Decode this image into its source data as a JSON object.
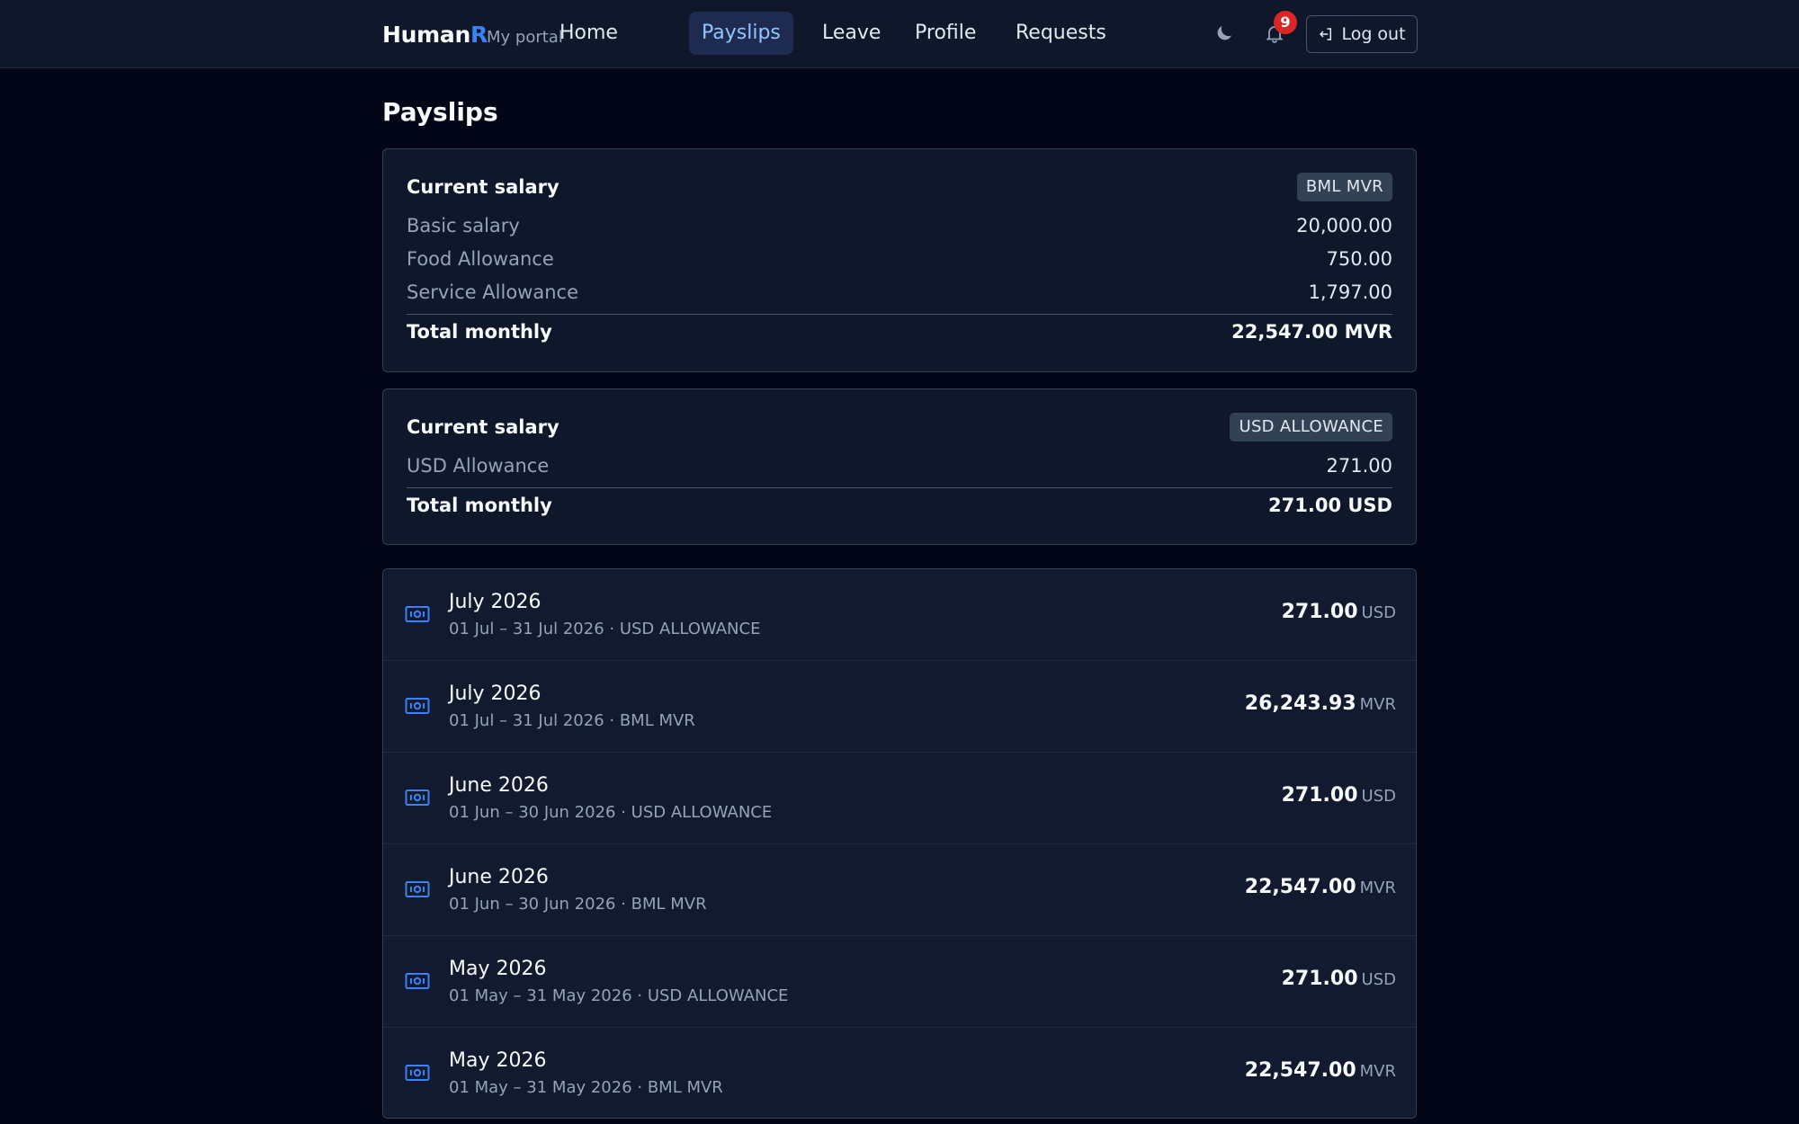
{
  "nav": {
    "brand_main": "Human",
    "brand_accent": "R",
    "portal": "My portal",
    "links": [
      {
        "label": "Home",
        "active": false
      },
      {
        "label": "Payslips",
        "active": true
      },
      {
        "label": "Leave",
        "active": false
      },
      {
        "label": "Profile",
        "active": false
      },
      {
        "label": "Requests",
        "active": false
      }
    ],
    "theme_icon": "moon-icon",
    "notifications_icon": "bell-icon",
    "notification_count": "9",
    "logout_label": "Log out",
    "logout_icon": "logout-icon"
  },
  "page": {
    "title": "Payslips"
  },
  "salary_cards": [
    {
      "title": "Current salary",
      "tag": "BML MVR",
      "lines": [
        {
          "label": "Basic salary",
          "value": "20,000.00"
        },
        {
          "label": "Food Allowance",
          "value": "750.00"
        },
        {
          "label": "Service Allowance",
          "value": "1,797.00"
        }
      ],
      "total_label": "Total monthly",
      "total_value": "22,547.00 MVR"
    },
    {
      "title": "Current salary",
      "tag": "USD ALLOWANCE",
      "lines": [
        {
          "label": "USD Allowance",
          "value": "271.00"
        }
      ],
      "total_label": "Total monthly",
      "total_value": "271.00 USD"
    }
  ],
  "payslips": [
    {
      "title": "July 2026",
      "sub": "01 Jul – 31 Jul 2026 · USD ALLOWANCE",
      "amount": "271.00",
      "currency": "USD",
      "icon": "banknote-icon"
    },
    {
      "title": "July 2026",
      "sub": "01 Jul – 31 Jul 2026 · BML MVR",
      "amount": "26,243.93",
      "currency": "MVR",
      "icon": "banknote-icon"
    },
    {
      "title": "June 2026",
      "sub": "01 Jun – 30 Jun 2026 · USD ALLOWANCE",
      "amount": "271.00",
      "currency": "USD",
      "icon": "banknote-icon"
    },
    {
      "title": "June 2026",
      "sub": "01 Jun – 30 Jun 2026 · BML MVR",
      "amount": "22,547.00",
      "currency": "MVR",
      "icon": "banknote-icon"
    },
    {
      "title": "May 2026",
      "sub": "01 May – 31 May 2026 · USD ALLOWANCE",
      "amount": "271.00",
      "currency": "USD",
      "icon": "banknote-icon"
    },
    {
      "title": "May 2026",
      "sub": "01 May – 31 May 2026 · BML MVR",
      "amount": "22,547.00",
      "currency": "MVR",
      "icon": "banknote-icon"
    }
  ],
  "colors": {
    "background": "#020617",
    "surface": "#0f172a",
    "accent": "#3b82f6",
    "badge": "#dc2626"
  }
}
